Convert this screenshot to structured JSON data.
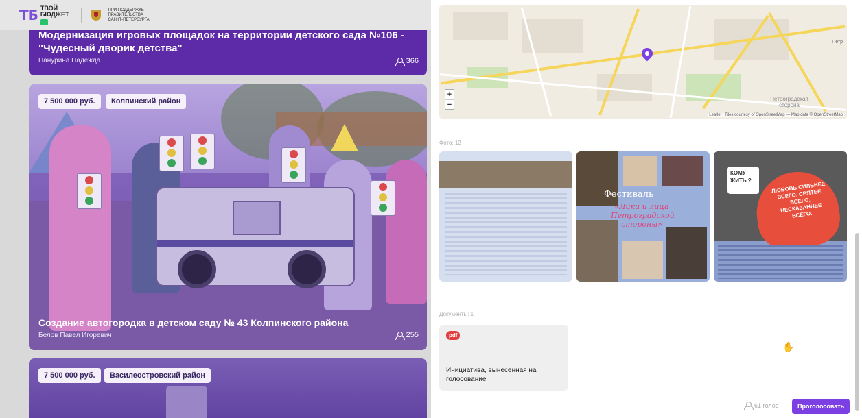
{
  "header": {
    "logo_mark": "ТБ",
    "logo_line1": "ТВОЙ",
    "logo_line2": "БЮДЖЕТ",
    "support_line1": "ПРИ ПОДДЕРЖКЕ",
    "support_line2": "ПРАВИТЕЛЬСТВА",
    "support_line3": "САНКТ-ПЕТЕРБУРГА"
  },
  "projects": [
    {
      "title": "Модернизация игровых площадок на территории детского сада №106 - \"Чудесный дворик детства\"",
      "author": "Панурина Надежда",
      "votes": "366"
    },
    {
      "price": "7 500 000 руб.",
      "district": "Колпинский район",
      "title": "Создание автогородка в детском саду № 43 Колпинского района",
      "author": "Белов Павел Игоревич",
      "votes": "255"
    },
    {
      "price": "7 500 000 руб.",
      "district": "Василеостровский район"
    }
  ],
  "detail": {
    "map_attribution": "Leaflet | Tiles courtesy of OpenStreetMap — Map data © OpenStreetMap",
    "map_labels": [
      "Петр",
      "Петроградская сторона"
    ],
    "photos_label": "Фото: 12",
    "photo2_title": "Фестиваль",
    "photo2_subtitle": "«Лики и лица Петроградской стороны»",
    "photo3_sign": "КОМУ ЖИТЬ ?",
    "photo3_heart": "ЛЮБОВЬ СИЛЬНЕЕ ВСЕГО, СВЯТЕЕ ВСЕГО, НЕСКАЗАННЕЕ ВСЕГО.",
    "documents_label": "Документы: 1",
    "doc_type": "pdf",
    "doc_title": "Инициатива, вынесенная на голосование",
    "vote_count": "61 голос",
    "vote_button": "Проголосовать"
  },
  "colors": {
    "accent": "#7b3fe4",
    "card_purple": "#5d2aa8",
    "pdf_red": "#e04040"
  }
}
